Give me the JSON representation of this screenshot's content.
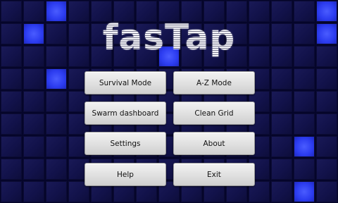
{
  "app": {
    "title": "fasTap"
  },
  "colors": {
    "background": "#05052a",
    "tile": "#14144c",
    "tile_lit": "#3040f5",
    "button": "#e4e4e4"
  },
  "menu": {
    "survival": "Survival Mode",
    "az": "A-Z Mode",
    "swarm": "Swarm dashboard",
    "clean": "Clean Grid",
    "settings": "Settings",
    "about": "About",
    "help": "Help",
    "exit": "Exit"
  }
}
